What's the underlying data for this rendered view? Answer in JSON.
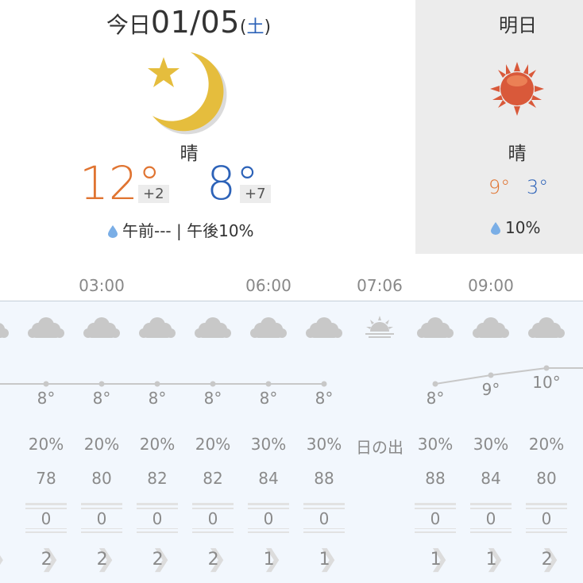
{
  "today": {
    "label": "今日",
    "date": "01/05",
    "weekday_open": "(",
    "weekday": "土",
    "weekday_close": ")",
    "condition": "晴",
    "high": "12°",
    "high_diff": "+2",
    "low": "8°",
    "low_diff": "+7",
    "rain": "午前--- | 午後10%",
    "icon": "moon-star-icon"
  },
  "tomorrow": {
    "label": "明日",
    "condition": "晴",
    "high": "9°",
    "low": "3°",
    "rain": "10%",
    "icon": "sun-icon"
  },
  "timeline": {
    "time_labels": [
      {
        "text": "03:00",
        "col": 1
      },
      {
        "text": "06:00",
        "col": 4
      },
      {
        "text": "07:06",
        "col": 5
      },
      {
        "text": "09:00",
        "col": 7
      }
    ],
    "columns": [
      {
        "icon": "cloud-icon",
        "temp": "",
        "precip": "%",
        "humidity": "",
        "wind": "",
        "wind_dir": "›"
      },
      {
        "icon": "cloud-icon",
        "temp": "8°",
        "precip": "20%",
        "humidity": "78",
        "wind": "0",
        "wind_dir": "2"
      },
      {
        "icon": "cloud-icon",
        "temp": "8°",
        "precip": "20%",
        "humidity": "80",
        "wind": "0",
        "wind_dir": "2"
      },
      {
        "icon": "cloud-icon",
        "temp": "8°",
        "precip": "20%",
        "humidity": "82",
        "wind": "0",
        "wind_dir": "2"
      },
      {
        "icon": "cloud-icon",
        "temp": "8°",
        "precip": "20%",
        "humidity": "82",
        "wind": "0",
        "wind_dir": "2"
      },
      {
        "icon": "cloud-icon",
        "temp": "8°",
        "precip": "30%",
        "humidity": "84",
        "wind": "0",
        "wind_dir": "1"
      },
      {
        "icon": "cloud-icon",
        "temp": "8°",
        "precip": "30%",
        "humidity": "88",
        "wind": "0",
        "wind_dir": "1"
      },
      {
        "icon": "sunrise-icon",
        "temp": "",
        "precip": "日の出",
        "humidity": "",
        "wind": "",
        "wind_dir": ""
      },
      {
        "icon": "cloud-icon",
        "temp": "8°",
        "precip": "30%",
        "humidity": "88",
        "wind": "0",
        "wind_dir": "1"
      },
      {
        "icon": "cloud-icon",
        "temp": "9°",
        "precip": "30%",
        "humidity": "84",
        "wind": "0",
        "wind_dir": "1"
      },
      {
        "icon": "cloud-icon",
        "temp": "10°",
        "precip": "20%",
        "humidity": "80",
        "wind": "0",
        "wind_dir": "2"
      }
    ]
  },
  "colors": {
    "high": "#e07431",
    "low": "#2c62b8",
    "moon": "#e5bd3d",
    "sun": "#d9593a",
    "cloud": "#c8c8c8",
    "timeline_bg": "#f2f7fd"
  }
}
